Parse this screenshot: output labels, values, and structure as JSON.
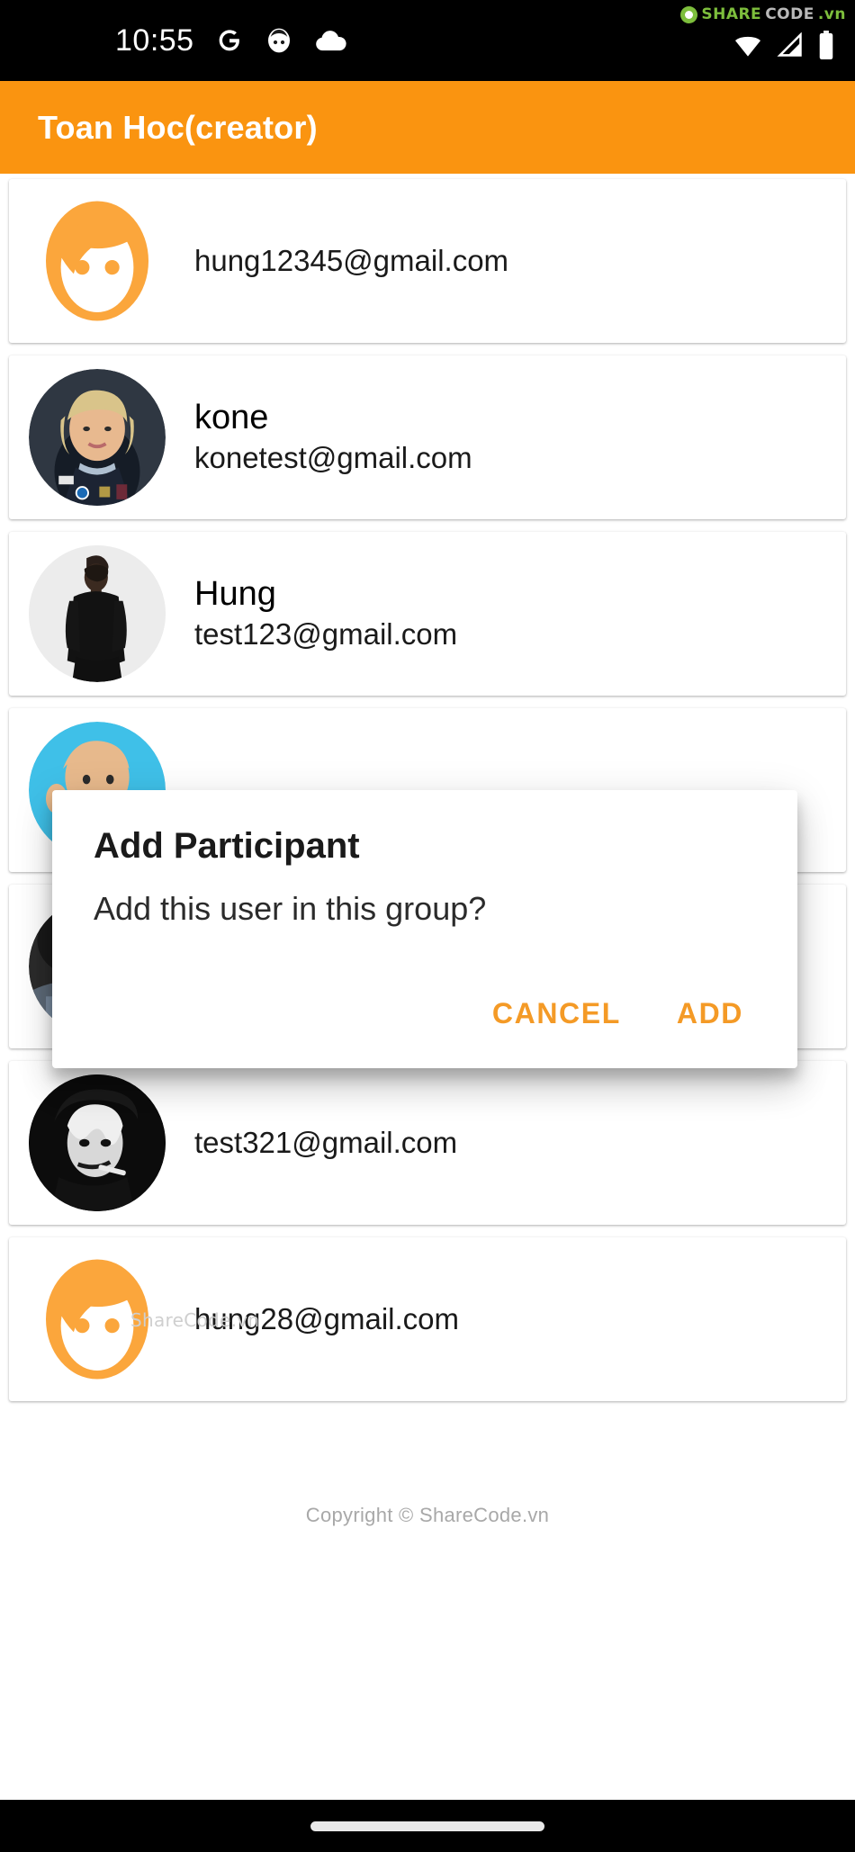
{
  "status_bar": {
    "time": "10:55",
    "left_icons": [
      "google-g-icon",
      "messenger-bot-icon",
      "cloud-icon"
    ],
    "right_icons": [
      "wifi-icon",
      "cellular-signal-icon",
      "battery-icon"
    ],
    "background_color": "#000000"
  },
  "watermark": {
    "share": "SHARE",
    "code": "CODE",
    "tld": ".vn",
    "share_color": "#7DBE3C",
    "code_color": "#b9b9b9"
  },
  "app_bar": {
    "title": "Toan Hoc(creator)",
    "background_color": "#FA9410",
    "title_color": "#FFFFFF"
  },
  "participants": [
    {
      "name": "",
      "email": "hung12345@gmail.com",
      "avatar": "default-person-avatar"
    },
    {
      "name": "kone",
      "email": "konetest@gmail.com",
      "avatar": "photo-blond-person-avatar"
    },
    {
      "name": "Hung",
      "email": "test123@gmail.com",
      "avatar": "photo-black-jacket-avatar"
    },
    {
      "name": "",
      "email": "",
      "avatar": "cartoon-blue-background-avatar"
    },
    {
      "name": "",
      "email": "",
      "avatar": "photo-dark-avatar"
    },
    {
      "name": "",
      "email": "test321@gmail.com",
      "avatar": "photo-bw-portrait-avatar"
    },
    {
      "name": "",
      "email": "hung28@gmail.com",
      "avatar": "default-person-avatar"
    }
  ],
  "dialog": {
    "title": "Add Participant",
    "message": "Add this user in this group?",
    "cancel_label": "CANCEL",
    "confirm_label": "ADD",
    "action_color": "#F49A26"
  },
  "footer": {
    "inline_watermark": "ShareCode.vn",
    "copyright": "Copyright © ShareCode.vn"
  },
  "nav_bar": {
    "gesture_pill": "home-gesture-pill"
  }
}
